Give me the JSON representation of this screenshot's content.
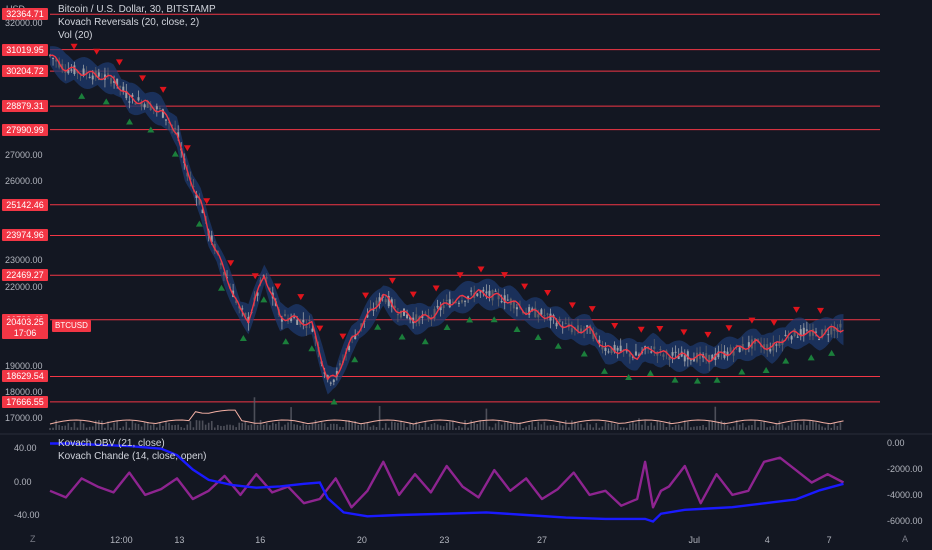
{
  "header": {
    "currency": "USD",
    "title": "Bitcoin / U.S. Dollar, 30, BITSTAMP",
    "indicator1": "Kovach Reversals (20, close, 2)",
    "indicator2": "Vol (20)"
  },
  "lower_pane": {
    "indicator1": "Kovach OBV (21, close)",
    "indicator2": "Kovach Chande (14, close, open)"
  },
  "current_price": {
    "value": "20403.25",
    "countdown": "17:06",
    "symbol": "BTCUSD"
  },
  "corner": {
    "left": "Z",
    "right": "A"
  },
  "colors": {
    "background": "#131722",
    "level_line": "#f23645",
    "buy_marker": "#1b7f3b",
    "sell_marker": "#e0141c",
    "band": "#1e3a6e",
    "obv": "#1a1aff",
    "chande": "#8e2490"
  },
  "chart_data": [
    {
      "type": "line",
      "title": "Bitcoin / U.S. Dollar, 30, BITSTAMP",
      "ylabel": "USD",
      "ylim": [
        16600,
        32600
      ],
      "grid": false,
      "y_ticks": [
        "32000.00",
        "26000.00",
        "27000.00",
        "23000.00",
        "22000.00",
        "19000.00",
        "18000.00",
        "17000.00"
      ],
      "y_tick_values": [
        32000,
        26000,
        27000,
        23000,
        22000,
        19000,
        18000,
        17000
      ],
      "x_ticks": [
        "12:00",
        "13",
        "16",
        "20",
        "23",
        "27",
        "Jul",
        "4",
        "7"
      ],
      "x_tick_positions": [
        0.09,
        0.163,
        0.265,
        0.393,
        0.497,
        0.62,
        0.812,
        0.904,
        0.982
      ],
      "levels": [
        "32364.71",
        "31019.95",
        "30204.72",
        "28879.31",
        "27990.99",
        "25142.46",
        "23974.96",
        "22469.27",
        "20780.43",
        "18629.54",
        "17666.55"
      ],
      "level_values": [
        32364.71,
        31019.95,
        30204.72,
        28879.31,
        27990.99,
        25142.46,
        23974.96,
        22469.27,
        20780.43,
        18629.54,
        17666.55
      ],
      "series": [
        {
          "x": [
            0,
            0.02,
            0.05,
            0.08,
            0.1,
            0.12,
            0.14,
            0.16,
            0.17,
            0.19,
            0.2,
            0.22,
            0.24,
            0.25,
            0.27,
            0.29,
            0.31,
            0.33,
            0.35,
            0.36,
            0.38,
            0.4,
            0.42,
            0.44,
            0.46,
            0.48,
            0.5,
            0.52,
            0.54,
            0.56,
            0.58,
            0.6,
            0.62,
            0.64,
            0.66,
            0.68,
            0.7,
            0.72,
            0.74,
            0.75,
            0.76,
            0.77,
            0.79,
            0.81,
            0.83,
            0.85,
            0.87,
            0.89,
            0.91,
            0.93,
            0.95,
            0.97,
            0.99,
            1.0
          ],
          "y": [
            30800,
            30300,
            30100,
            29900,
            29200,
            29000,
            28700,
            27900,
            26600,
            25200,
            24100,
            22600,
            21100,
            20800,
            22500,
            20900,
            20800,
            20600,
            18500,
            18600,
            20000,
            20900,
            21700,
            21100,
            20800,
            20900,
            21400,
            21600,
            21800,
            21700,
            21500,
            21100,
            21000,
            20700,
            20400,
            20400,
            19700,
            19600,
            19400,
            19600,
            19700,
            19500,
            19400,
            19400,
            19300,
            19500,
            19700,
            19900,
            19700,
            20200,
            20300,
            20200,
            20500,
            20400
          ]
        }
      ]
    },
    {
      "type": "line",
      "title": "Kovach OBV (21, close) / Kovach Chande (14, close, open)",
      "left_ticks": [
        "40.00",
        "0.00",
        "-40.00"
      ],
      "left_tick_values": [
        40,
        0,
        -40
      ],
      "right_ticks": [
        "0.00",
        "-2000.00",
        "-4000.00",
        "-6000.00"
      ],
      "right_tick_values": [
        0,
        -2000,
        -4000,
        -6000
      ],
      "series": [
        {
          "name": "Kovach OBV (21, close)",
          "x": [
            0,
            0.03,
            0.06,
            0.1,
            0.14,
            0.16,
            0.18,
            0.2,
            0.23,
            0.26,
            0.29,
            0.32,
            0.34,
            0.35,
            0.37,
            0.4,
            0.44,
            0.5,
            0.55,
            0.6,
            0.65,
            0.7,
            0.75,
            0.76,
            0.77,
            0.8,
            0.83,
            0.86,
            0.9,
            0.94,
            0.97,
            1.0
          ],
          "y": [
            0,
            0,
            -100,
            -200,
            -400,
            -900,
            -2000,
            -2800,
            -3200,
            -3400,
            -3300,
            -3100,
            -3000,
            -4200,
            -5300,
            -5600,
            -5500,
            -5400,
            -5300,
            -5500,
            -5700,
            -5800,
            -5800,
            -6000,
            -5400,
            -5100,
            -5000,
            -4900,
            -4600,
            -4300,
            -3600,
            -3100
          ]
        },
        {
          "name": "Kovach Chande (14, close, open)",
          "x": [
            0,
            0.02,
            0.04,
            0.06,
            0.08,
            0.1,
            0.12,
            0.14,
            0.16,
            0.18,
            0.2,
            0.22,
            0.24,
            0.26,
            0.28,
            0.3,
            0.32,
            0.34,
            0.36,
            0.38,
            0.4,
            0.42,
            0.44,
            0.46,
            0.48,
            0.5,
            0.52,
            0.54,
            0.56,
            0.58,
            0.6,
            0.62,
            0.64,
            0.66,
            0.68,
            0.7,
            0.72,
            0.74,
            0.75,
            0.76,
            0.77,
            0.78,
            0.8,
            0.82,
            0.84,
            0.86,
            0.88,
            0.9,
            0.92,
            0.94,
            0.96,
            0.98,
            1.0
          ],
          "y": [
            -10,
            -18,
            5,
            -5,
            -12,
            12,
            -15,
            -8,
            5,
            -20,
            -10,
            8,
            -15,
            10,
            -12,
            -5,
            -25,
            -20,
            5,
            -30,
            -10,
            25,
            -15,
            10,
            -12,
            20,
            -5,
            -18,
            15,
            -10,
            5,
            -20,
            -8,
            12,
            -15,
            -10,
            -28,
            -20,
            25,
            -30,
            -10,
            -5,
            20,
            -25,
            10,
            -15,
            -10,
            25,
            30,
            15,
            0,
            10,
            0
          ]
        }
      ]
    }
  ]
}
